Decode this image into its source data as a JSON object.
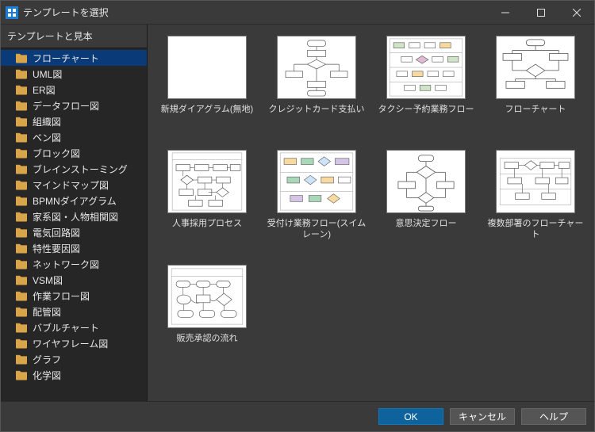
{
  "window": {
    "title": "テンプレートを選択"
  },
  "sidebar": {
    "header": "テンプレートと見本",
    "items": [
      {
        "label": "フローチャート",
        "selected": true
      },
      {
        "label": "UML図"
      },
      {
        "label": "ER図"
      },
      {
        "label": "データフロー図"
      },
      {
        "label": "組織図"
      },
      {
        "label": "ベン図"
      },
      {
        "label": "ブロック図"
      },
      {
        "label": "ブレインストーミング"
      },
      {
        "label": "マインドマップ図"
      },
      {
        "label": "BPMNダイアグラム"
      },
      {
        "label": "家系図・人物相関図"
      },
      {
        "label": "電気回路図"
      },
      {
        "label": "特性要因図"
      },
      {
        "label": "ネットワーク図"
      },
      {
        "label": "VSM図"
      },
      {
        "label": "作業フロー図"
      },
      {
        "label": "配管図"
      },
      {
        "label": "バブルチャート"
      },
      {
        "label": "ワイヤフレーム図"
      },
      {
        "label": "グラフ"
      },
      {
        "label": "化学図"
      }
    ]
  },
  "gallery": {
    "items": [
      {
        "label": "新規ダイアグラム(無地)",
        "kind": "blank"
      },
      {
        "label": "クレジットカード支払い",
        "kind": "flow1"
      },
      {
        "label": "タクシー予約業務フロー",
        "kind": "swim1"
      },
      {
        "label": "フローチャート",
        "kind": "flow2"
      },
      {
        "label": "人事採用プロセス",
        "kind": "flow3"
      },
      {
        "label": "受付け業務フロー(スイムレーン)",
        "kind": "swim2"
      },
      {
        "label": "意思決定フロー",
        "kind": "decision"
      },
      {
        "label": "複数部署のフローチャート",
        "kind": "swim3"
      },
      {
        "label": "販売承認の流れ",
        "kind": "flow4"
      }
    ]
  },
  "footer": {
    "ok": "OK",
    "cancel": "キャンセル",
    "help": "ヘルプ"
  }
}
